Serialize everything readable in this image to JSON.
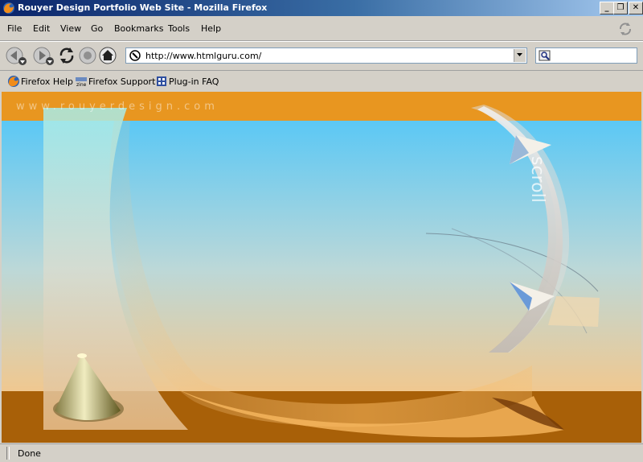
{
  "window": {
    "title": "Rouyer Design Portfolio Web Site - Mozilla Firefox",
    "controls": [
      "minimize",
      "restore",
      "close"
    ]
  },
  "menubar": {
    "items": [
      {
        "label": "File"
      },
      {
        "label": "Edit"
      },
      {
        "label": "View"
      },
      {
        "label": "Go"
      },
      {
        "label": "Bookmarks"
      },
      {
        "label": "Tools"
      },
      {
        "label": "Help"
      }
    ]
  },
  "navigation": {
    "buttons": [
      "back-icon",
      "forward-icon",
      "reload-icon",
      "stop-icon",
      "home-icon"
    ],
    "url": "http://www.htmlguru.com/",
    "search_value": ""
  },
  "bookmarks": {
    "items": [
      {
        "label": "Firefox Help",
        "icon": "firefox-icon"
      },
      {
        "label": "Firefox Support",
        "icon": "zine-icon"
      },
      {
        "label": "Plug-in FAQ",
        "icon": "plugin-icon"
      }
    ]
  },
  "page": {
    "watermark": "www.rouyerdesign.com",
    "scroll_label": "scroll",
    "colors": {
      "orange": "#e89620",
      "sky": "#5bc8f5",
      "sand": "#f0c890",
      "ground": "#a86008"
    }
  },
  "status": {
    "text": "Done"
  }
}
